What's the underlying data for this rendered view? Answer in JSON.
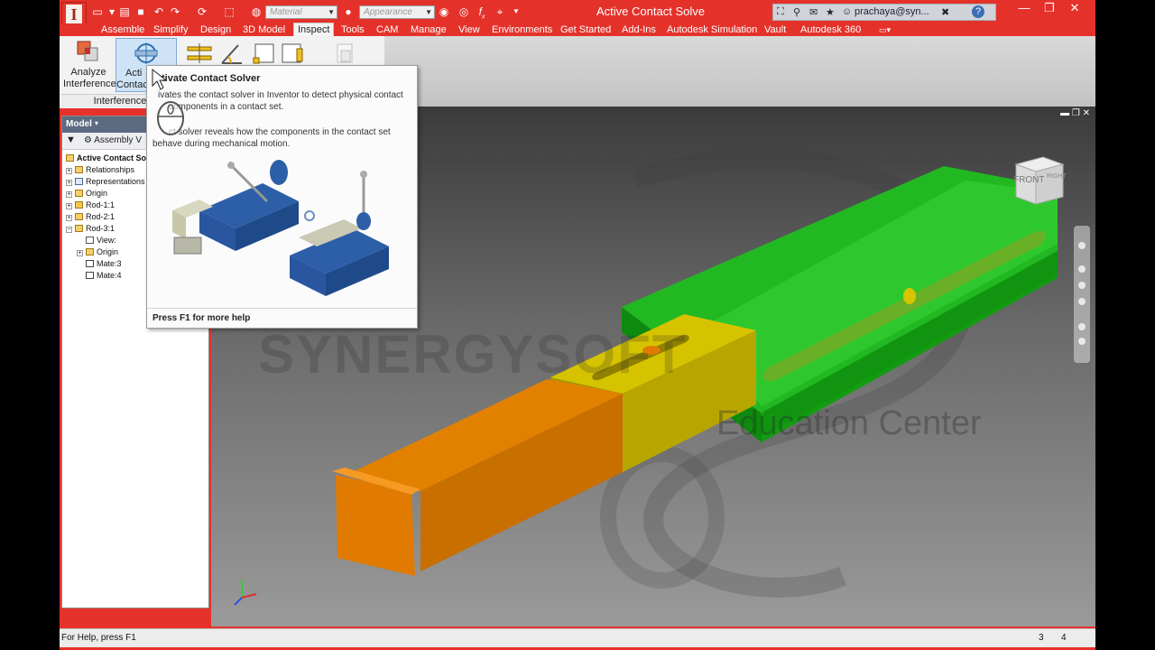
{
  "window": {
    "title": "Active Contact Solve",
    "user": "prachaya@syn...",
    "controls": [
      "minimize",
      "restore",
      "close"
    ]
  },
  "quick_access": {
    "material_placeholder": "Material",
    "appearance_placeholder": "Appearance",
    "fx_label": "f",
    "fx_sub": "x"
  },
  "menu_tabs": [
    {
      "label": "Assemble",
      "active": false
    },
    {
      "label": "Simplify",
      "active": false
    },
    {
      "label": "Design",
      "active": false
    },
    {
      "label": "3D Model",
      "active": false
    },
    {
      "label": "Inspect",
      "active": true
    },
    {
      "label": "Tools",
      "active": false
    },
    {
      "label": "CAM",
      "active": false
    },
    {
      "label": "Manage",
      "active": false
    },
    {
      "label": "View",
      "active": false
    },
    {
      "label": "Environments",
      "active": false
    },
    {
      "label": "Get Started",
      "active": false
    },
    {
      "label": "Add-Ins",
      "active": false
    },
    {
      "label": "Autodesk Simulation",
      "active": false
    },
    {
      "label": "Vault",
      "active": false
    },
    {
      "label": "Autodesk 360",
      "active": false
    }
  ],
  "ribbon": {
    "analyze_interference_line1": "Analyze",
    "analyze_interference_line2": "Interference",
    "active_contact_line1": "Acti",
    "active_contact_line2": "Contac",
    "panel_label": "Interference"
  },
  "browser": {
    "title": "Model",
    "filter_label": "Assembly V",
    "items": [
      {
        "label": "Active Contact So",
        "bold": true,
        "level": 0,
        "icon": "assembly-icon"
      },
      {
        "label": "Relationships",
        "level": 1,
        "icon": "folder-icon"
      },
      {
        "label": "Representations",
        "level": 1,
        "icon": "representations-icon"
      },
      {
        "label": "Origin",
        "level": 1,
        "icon": "folder-icon"
      },
      {
        "label": "Rod-1:1",
        "level": 1,
        "icon": "grounded-part-icon"
      },
      {
        "label": "Rod-2:1",
        "level": 1,
        "icon": "part-icon"
      },
      {
        "label": "Rod-3:1",
        "level": 1,
        "icon": "part-icon"
      },
      {
        "label": "View:",
        "level": 2,
        "icon": "view-icon"
      },
      {
        "label": "Origin",
        "level": 2,
        "icon": "folder-icon"
      },
      {
        "label": "Mate:3",
        "level": 2,
        "icon": "mate-icon"
      },
      {
        "label": "Mate:4",
        "level": 2,
        "icon": "mate-icon"
      }
    ]
  },
  "tooltip": {
    "title": "tivate Contact Solver",
    "desc1_line1": "ivates the contact solver in Inventor to detect physical contact",
    "desc1_line2": "components in a contact set.",
    "desc2_line1": "ct solver reveals how the components in the contact set",
    "desc2_line2": "behave during mechanical motion.",
    "footer": "Press F1 for more help"
  },
  "viewport": {
    "watermark_line1": "SYNERGYSOFT",
    "watermark_line2": "Education Center",
    "viewcube_front": "FRONT",
    "viewcube_right": "RIGHT",
    "part_colors": {
      "rod1": "#e07a00",
      "rod2": "#d8c400",
      "rod3": "#18b818"
    }
  },
  "status": {
    "help_text": "For Help, press F1",
    "count_a": "3",
    "count_b": "4"
  }
}
